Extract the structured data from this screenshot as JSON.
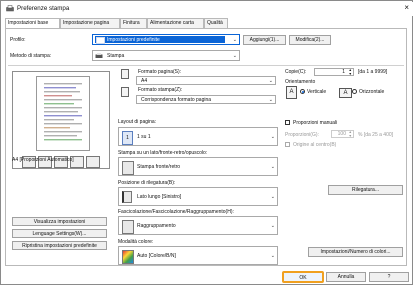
{
  "window": {
    "title": "Preferenze stampa"
  },
  "tabs": [
    {
      "label": "Impostazioni base"
    },
    {
      "label": "Impostazione pagina"
    },
    {
      "label": "Finitura"
    },
    {
      "label": "Alimentazione carta"
    },
    {
      "label": "Qualità"
    }
  ],
  "profile": {
    "label": "Profilo:",
    "value": "Impostazioni predefinite",
    "add_label": "Aggiungi(1)...",
    "edit_label": "Modifica(2)..."
  },
  "output_method": {
    "label": "Metodo di stampa:",
    "value": "Stampa"
  },
  "preview": {
    "caption": "A4 [Proporzioni Automatico]"
  },
  "page_size": {
    "label": "Formato pagina(S):",
    "value": "A4"
  },
  "output_size": {
    "label": "Formato stampa(Z):",
    "value": "Corrispondenza formato pagina"
  },
  "copies": {
    "label": "Copie(C):",
    "value": "1",
    "range": "[da 1 a 9999]"
  },
  "orientation": {
    "label": "Orientamento",
    "portrait": "Verticale",
    "landscape": "Orizzontale"
  },
  "layout": {
    "label": "Layout di pagina:",
    "value": "1 su 1"
  },
  "manual_scaling": {
    "label": "Proporzioni manuali",
    "scaling_label": "Proporzioni(G):",
    "scaling_value": "100",
    "scaling_range": "% [da 25 a 400]",
    "center_label": "Origine al centro(B)"
  },
  "duplex": {
    "label": "Stampa su un lato/fronte-retro/opuscolo:",
    "value": "Stampa fronte/retro"
  },
  "binding": {
    "label": "Posizione di rilegatura(B):",
    "value": "Lato lungo [Sinistro]",
    "margin_button": "Rilegatura..."
  },
  "collate": {
    "label": "Fascicolazione/Fascicolazione/Raggruppamento(H):",
    "value": "Raggruppamento"
  },
  "color_mode": {
    "label": "Modalità colore:",
    "value": "Auto [Colore/B/N]",
    "color_settings_button": "Impostazioni/Numero di colori..."
  },
  "side_buttons": {
    "view_settings": "Visualizza impostazioni",
    "language": "Lenguage Settings(W)...",
    "restore": "Ripristina impostazioni predefinite"
  },
  "footer": {
    "ok": "OK",
    "cancel": "Annulla",
    "help": "?"
  }
}
